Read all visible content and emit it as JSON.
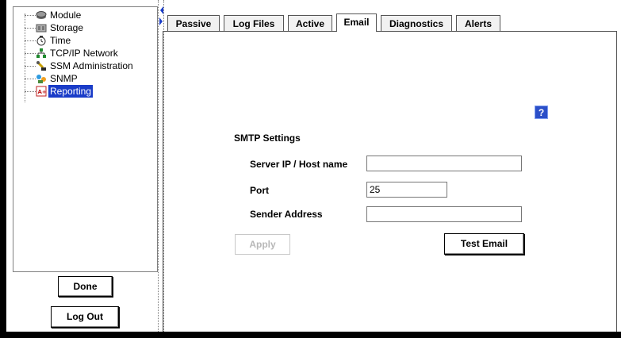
{
  "tree": {
    "items": [
      {
        "label": "Module",
        "icon": "module-icon"
      },
      {
        "label": "Storage",
        "icon": "storage-icon"
      },
      {
        "label": "Time",
        "icon": "clock-icon"
      },
      {
        "label": "TCP/IP Network",
        "icon": "network-icon"
      },
      {
        "label": "SSM Administration",
        "icon": "admin-icon"
      },
      {
        "label": "SNMP",
        "icon": "snmp-icon"
      },
      {
        "label": "Reporting",
        "icon": "reporting-icon"
      }
    ],
    "selected": "Reporting",
    "selection_color": "#1a3cc8"
  },
  "buttons": {
    "done": "Done",
    "logout": "Log Out",
    "apply": "Apply",
    "test_email": "Test Email"
  },
  "tabs": [
    "Passive",
    "Log Files",
    "Active",
    "Email",
    "Diagnostics",
    "Alerts"
  ],
  "active_tab": "Email",
  "help_icon": "?",
  "smtp": {
    "section_title": "SMTP Settings",
    "server_label": "Server IP / Host name",
    "server_value": "",
    "port_label": "Port",
    "port_value": "25",
    "sender_label": "Sender Address",
    "sender_value": ""
  }
}
